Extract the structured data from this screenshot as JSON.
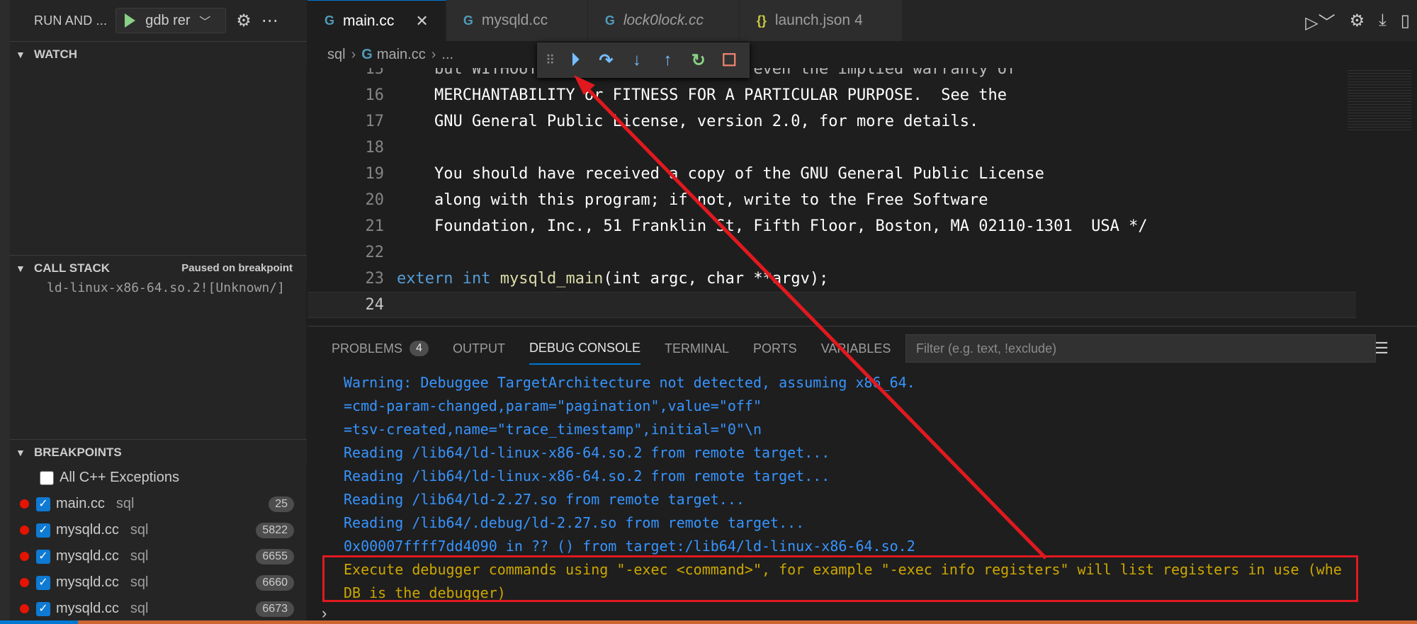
{
  "sidebar": {
    "title": "RUN AND ...",
    "run_config": "gdb rer",
    "sections": {
      "watch": "WATCH",
      "call_stack": "CALL STACK",
      "call_stack_status": "Paused on breakpoint",
      "breakpoints": "BREAKPOINTS"
    },
    "call_stack_frame": "ld-linux-x86-64.so.2![Unknown/]",
    "exceptions_label": "All C++ Exceptions",
    "breakpoints": [
      {
        "file": "main.cc",
        "folder": "sql",
        "line": "25"
      },
      {
        "file": "mysqld.cc",
        "folder": "sql",
        "line": "5822"
      },
      {
        "file": "mysqld.cc",
        "folder": "sql",
        "line": "6655"
      },
      {
        "file": "mysqld.cc",
        "folder": "sql",
        "line": "6660"
      },
      {
        "file": "mysqld.cc",
        "folder": "sql",
        "line": "6673"
      }
    ]
  },
  "tabs": [
    {
      "label": "main.cc",
      "icon": "G",
      "active": true
    },
    {
      "label": "mysqld.cc",
      "icon": "G"
    },
    {
      "label": "lock0lock.cc",
      "icon": "G",
      "italic": true
    },
    {
      "label": "launch.json",
      "icon": "{}",
      "count": "4"
    }
  ],
  "breadcrumb": {
    "folder": "sql",
    "file": "main.cc",
    "more": "..."
  },
  "code": {
    "lines": [
      {
        "n": "16",
        "text": "    MERCHANTABILITY or FITNESS FOR A PARTICULAR PURPOSE.  See the"
      },
      {
        "n": "17",
        "text": "    GNU General Public License, version 2.0, for more details."
      },
      {
        "n": "18",
        "text": ""
      },
      {
        "n": "19",
        "text": "    You should have received a copy of the GNU General Public License"
      },
      {
        "n": "20",
        "text": "    along with this program; if not, write to the Free Software"
      },
      {
        "n": "21",
        "text": "    Foundation, Inc., 51 Franklin St, Fifth Floor, Boston, MA 02110-1301  USA */"
      },
      {
        "n": "22",
        "text": ""
      }
    ],
    "line23": {
      "n": "23",
      "kw1": "extern",
      "kw2": "int",
      "fn": "mysqld_main",
      "args": "(int argc, char **argv);"
    },
    "line24": {
      "n": "24"
    }
  },
  "panel": {
    "tabs": [
      {
        "label": "PROBLEMS",
        "badge": "4"
      },
      {
        "label": "OUTPUT"
      },
      {
        "label": "DEBUG CONSOLE",
        "active": true
      },
      {
        "label": "TERMINAL"
      },
      {
        "label": "PORTS"
      },
      {
        "label": "VARIABLES"
      }
    ],
    "filter_placeholder": "Filter (e.g. text, !exclude)"
  },
  "console": [
    {
      "text": "Warning: Debuggee TargetArchitecture not detected, assuming x86_64.",
      "kind": "blue"
    },
    {
      "text": "=cmd-param-changed,param=\"pagination\",value=\"off\"",
      "kind": "blue"
    },
    {
      "text": "=tsv-created,name=\"trace_timestamp\",initial=\"0\"\\n",
      "kind": "blue"
    },
    {
      "text": "Reading /lib64/ld-linux-x86-64.so.2 from remote target...",
      "kind": "blue"
    },
    {
      "text": "Reading /lib64/ld-linux-x86-64.so.2 from remote target...",
      "kind": "blue"
    },
    {
      "text": "Reading /lib64/ld-2.27.so from remote target...",
      "kind": "blue"
    },
    {
      "text": "Reading /lib64/.debug/ld-2.27.so from remote target...",
      "kind": "blue"
    },
    {
      "text": "0x00007ffff7dd4090 in ?? () from target:/lib64/ld-linux-x86-64.so.2",
      "kind": "blue"
    },
    {
      "text": "Execute debugger commands using \"-exec <command>\", for example \"-exec info registers\" will list registers in use (whe",
      "kind": "warn"
    },
    {
      "text": "DB is the debugger)",
      "kind": "warn"
    }
  ],
  "colors": {
    "accent": "#0078d4",
    "annotation": "#e0191f",
    "breakpoint": "#e51400"
  }
}
